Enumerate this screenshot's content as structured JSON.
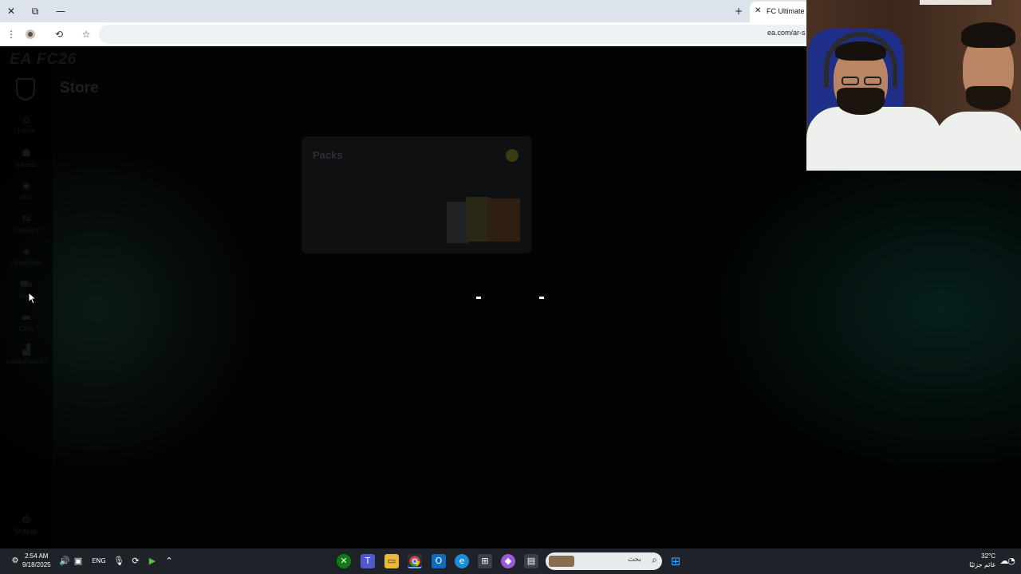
{
  "browser": {
    "tab_title": "FC Ultimate Te",
    "tab_close": "✕",
    "url": "ea.com/ar-s",
    "window_controls": {
      "close": "✕",
      "restore": "⧉",
      "minimize": "—"
    },
    "new_tab": "+",
    "toolbar": {
      "menu": "⋮",
      "extensions": "⟲",
      "bookmark": "☆"
    }
  },
  "page": {
    "logo": "EA FC26",
    "title": "Store",
    "nav": [
      {
        "label": "Home",
        "icon": "home-icon",
        "glyph": "⌂"
      },
      {
        "label": "Squads",
        "icon": "squads-icon",
        "glyph": "☗"
      },
      {
        "label": "SBC",
        "icon": "sbc-icon",
        "glyph": "◉"
      },
      {
        "label": "Transfers",
        "icon": "transfers-icon",
        "glyph": "⇆"
      },
      {
        "label": "Objectives",
        "icon": "objectives-icon",
        "glyph": "◈"
      },
      {
        "label": "Store",
        "icon": "store-icon",
        "glyph": "⛟"
      },
      {
        "label": "Club",
        "icon": "club-icon",
        "glyph": "▬"
      },
      {
        "label": "Leaderboards",
        "icon": "leaderboards-icon",
        "glyph": "▟"
      }
    ],
    "settings_label": "Settings",
    "settings_icon": "⚙",
    "card": {
      "label": "Packs"
    }
  },
  "taskbar": {
    "time": "2:54 AM",
    "date": "9/18/2025",
    "language": "ENG",
    "search_placeholder": "بحث",
    "search_glyph": "⌕",
    "temperature": "32°C",
    "weather_text": "غائم جزئيًا",
    "icons": [
      "xbox-icon",
      "teams-icon",
      "file-explorer-icon",
      "chrome-icon",
      "outlook-icon",
      "edge-icon",
      "store-icon",
      "copilot-icon",
      "task-view-icon",
      "windows-start-icon"
    ]
  },
  "colors": {
    "chrome_tabbar": "#dde3ea",
    "page_bg": "#020303",
    "taskbar_bg": "#1f2228",
    "card_dot": "#3b3a10"
  }
}
